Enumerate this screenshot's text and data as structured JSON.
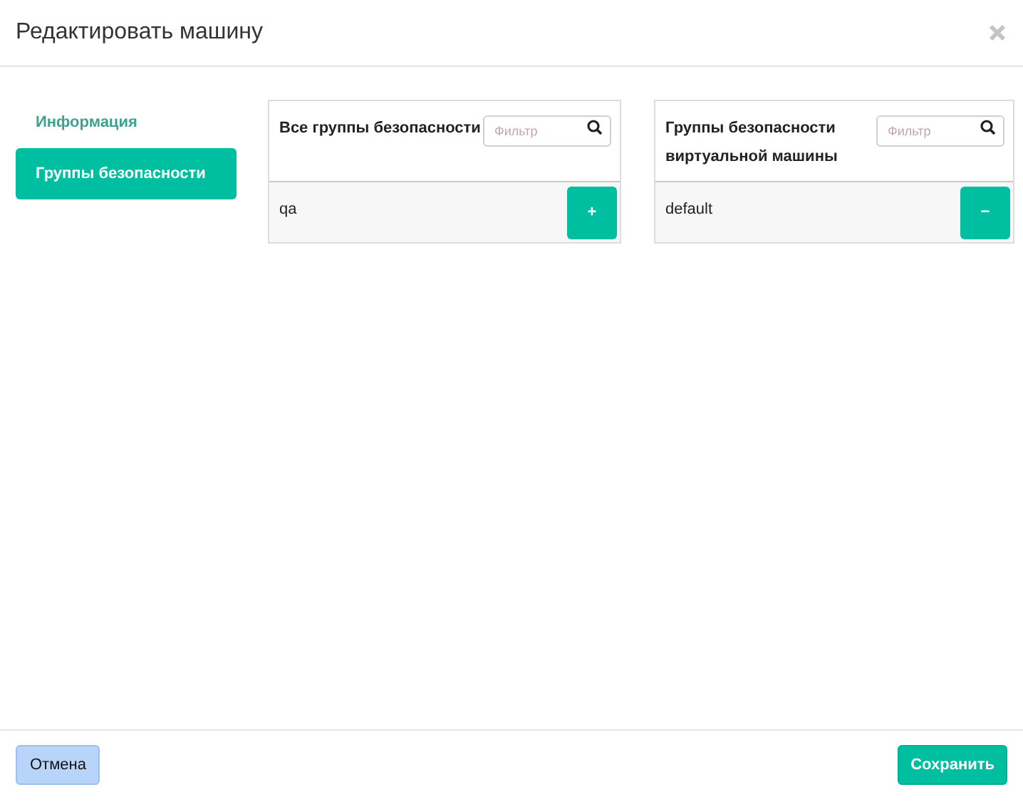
{
  "window": {
    "title": "Редактировать машину"
  },
  "tabs": [
    {
      "label": "Информация",
      "selected": false
    },
    {
      "label": "Группы безопасности",
      "selected": true
    }
  ],
  "panels": [
    {
      "title": "Все группы безопасности",
      "filter": {
        "placeholder": "Фильтр"
      },
      "rows": [
        {
          "label": "qa",
          "action": "+"
        }
      ]
    },
    {
      "title": "Группы безопасности виртуальной машины",
      "filter": {
        "placeholder": "Фильтр"
      },
      "rows": [
        {
          "label": "default",
          "action": "−"
        }
      ]
    }
  ],
  "footer_buttons": [
    {
      "label": "Отмена",
      "kind": "secondary"
    },
    {
      "label": "Сохранить",
      "kind": "primary"
    }
  ]
}
